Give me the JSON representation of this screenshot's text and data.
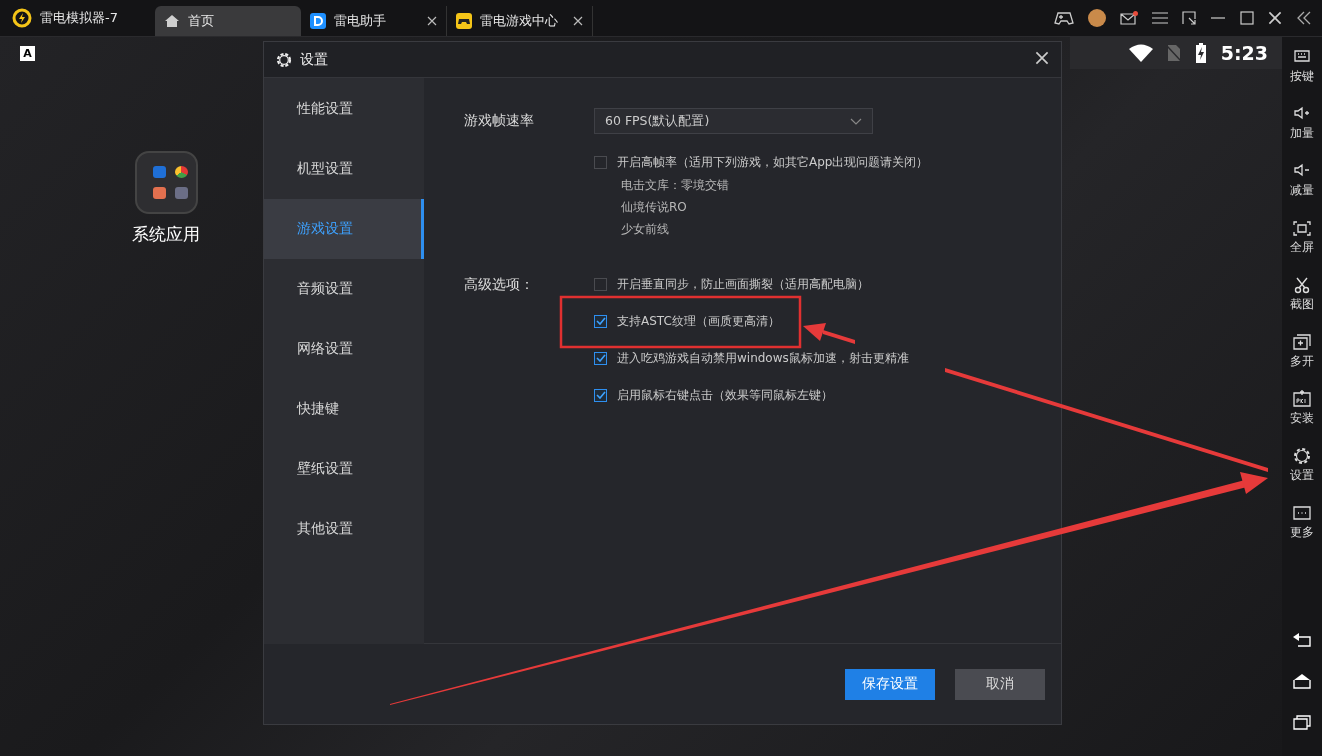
{
  "window": {
    "app_title": "雷电模拟器-7",
    "tabs": [
      {
        "label": "首页",
        "selected": true,
        "closable": false
      },
      {
        "label": "雷电助手",
        "selected": false,
        "closable": true
      },
      {
        "label": "雷电游戏中心",
        "selected": false,
        "closable": true
      }
    ],
    "mail_unread": true
  },
  "status_bar": {
    "notification": "A",
    "time": "5:23"
  },
  "desktop": {
    "folder_label": "系统应用"
  },
  "dialog": {
    "title": "设置",
    "nav": [
      {
        "label": "性能设置",
        "selected": false
      },
      {
        "label": "机型设置",
        "selected": false
      },
      {
        "label": "游戏设置",
        "selected": true
      },
      {
        "label": "音频设置",
        "selected": false
      },
      {
        "label": "网络设置",
        "selected": false
      },
      {
        "label": "快捷键",
        "selected": false
      },
      {
        "label": "壁纸设置",
        "selected": false
      },
      {
        "label": "其他设置",
        "selected": false
      }
    ],
    "frame_rate": {
      "label": "游戏帧速率",
      "value": "60 FPS(默认配置)"
    },
    "high_frame": {
      "label": "开启高帧率（适用下列游戏，如其它App出现问题请关闭）",
      "checked": false,
      "games": [
        "电击文库：零境交错",
        "仙境传说RO",
        "少女前线"
      ]
    },
    "advanced": {
      "label": "高级选项：",
      "options": [
        {
          "label": "开启垂直同步，防止画面撕裂（适用高配电脑）",
          "checked": false
        },
        {
          "label": "支持ASTC纹理（画质更高清）",
          "checked": true
        },
        {
          "label": "进入吃鸡游戏自动禁用windows鼠标加速，射击更精准",
          "checked": true
        },
        {
          "label": "启用鼠标右键点击（效果等同鼠标左键）",
          "checked": true
        }
      ]
    },
    "buttons": [
      {
        "label": "保存设置",
        "kind": "primary"
      },
      {
        "label": "取消",
        "kind": "secondary"
      }
    ]
  },
  "sidebar": {
    "tools": [
      {
        "label": "按键"
      },
      {
        "label": "加量"
      },
      {
        "label": "减量"
      },
      {
        "label": "全屏"
      },
      {
        "label": "截图"
      },
      {
        "label": "多开"
      },
      {
        "label": "安装"
      },
      {
        "label": "设置"
      },
      {
        "label": "更多"
      }
    ]
  }
}
